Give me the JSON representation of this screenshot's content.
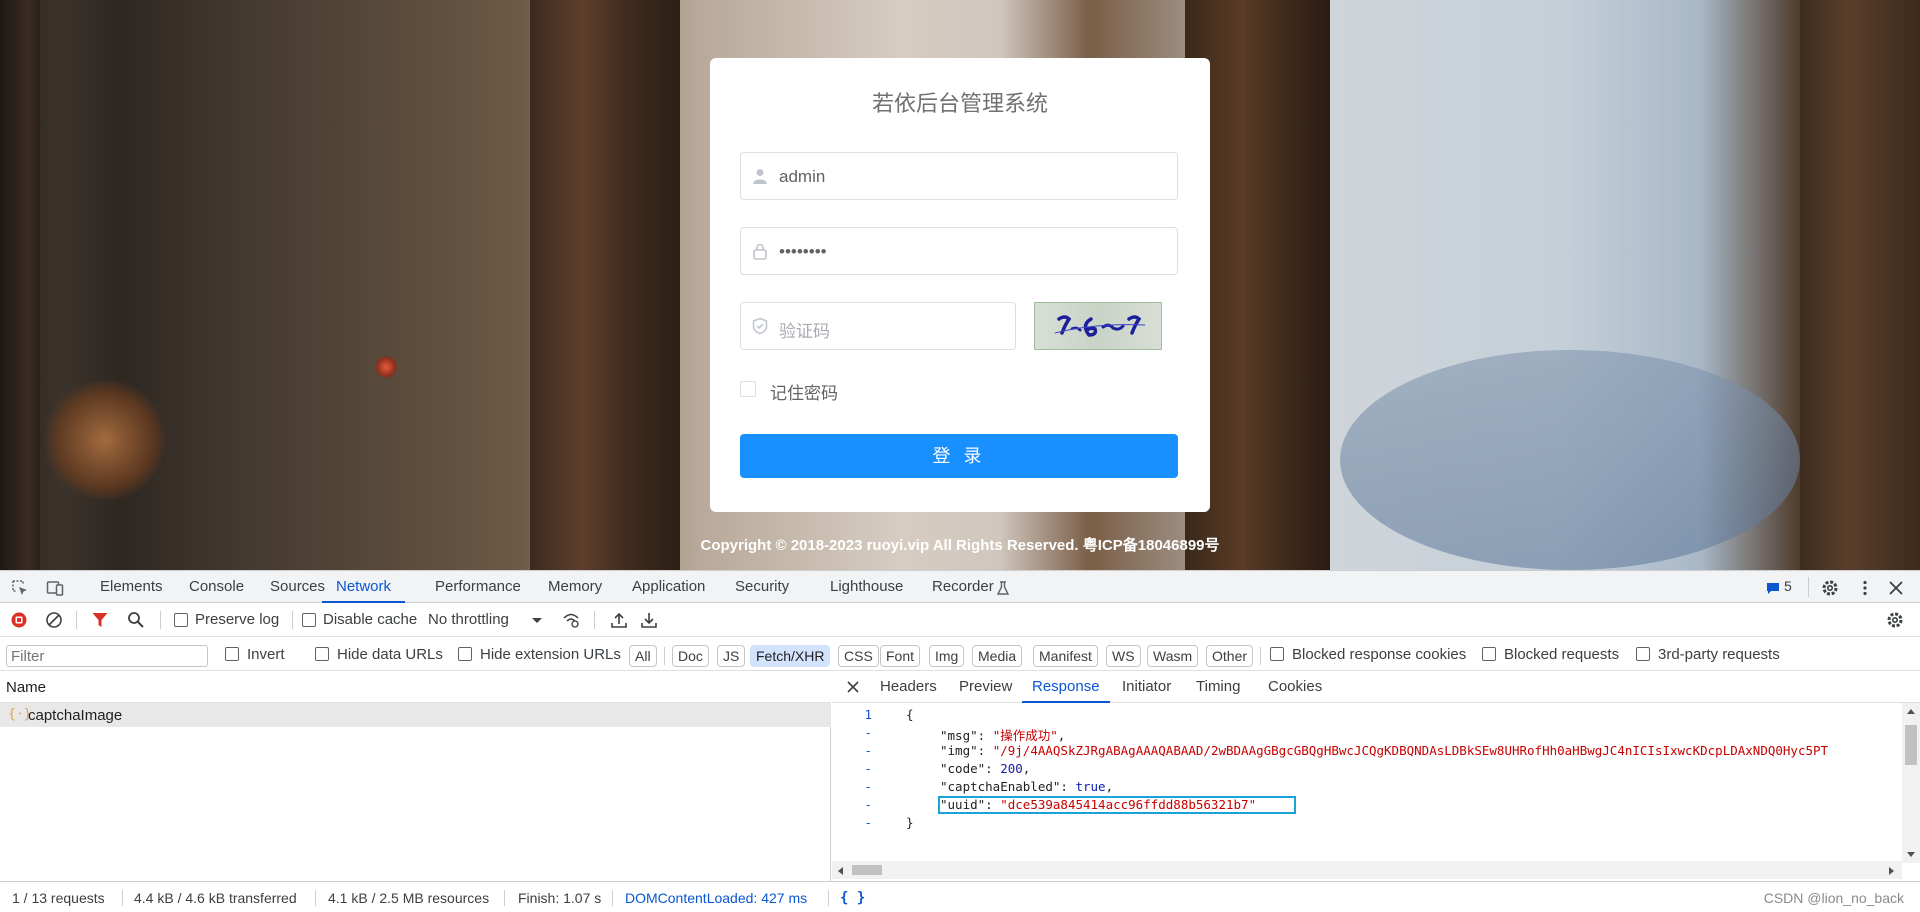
{
  "login": {
    "title": "若依后台管理系统",
    "username": "admin",
    "password_mask": "••••••••",
    "code_placeholder": "验证码",
    "remember_label": "记住密码",
    "login_button": "登 录",
    "copyright": "Copyright © 2018-2023 ruoyi.vip All Rights Reserved. 粤ICP备18046899号"
  },
  "devtools": {
    "tabs": [
      "Elements",
      "Console",
      "Sources",
      "Network",
      "Performance",
      "Memory",
      "Application",
      "Security",
      "Lighthouse",
      "Recorder"
    ],
    "active_tab": "Network",
    "issues_count": "5",
    "toolbar": {
      "preserve_log": "Preserve log",
      "disable_cache": "Disable cache",
      "throttling": "No throttling"
    },
    "filter": {
      "placeholder": "Filter",
      "invert": "Invert",
      "hide_data_urls": "Hide data URLs",
      "hide_extension_urls": "Hide extension URLs",
      "types": [
        "All",
        "Doc",
        "JS",
        "Fetch/XHR",
        "CSS",
        "Font",
        "Img",
        "Media",
        "Manifest",
        "WS",
        "Wasm",
        "Other"
      ],
      "active_type": "Fetch/XHR",
      "blocked_response_cookies": "Blocked response cookies",
      "blocked_requests": "Blocked requests",
      "third_party": "3rd-party requests"
    },
    "name_header": "Name",
    "requests": [
      {
        "name": "captchaImage"
      }
    ],
    "detail_tabs": [
      "Headers",
      "Preview",
      "Response",
      "Initiator",
      "Timing",
      "Cookies"
    ],
    "active_detail_tab": "Response",
    "response": {
      "line_numbers": [
        "1",
        "-",
        "-",
        "-",
        "-",
        "-",
        "-"
      ],
      "open_brace": "{",
      "close_brace": "}",
      "msg_key": "\"msg\"",
      "msg_val": "\"操作成功\"",
      "img_key": "\"img\"",
      "img_val": "\"/9j/4AAQSkZJRgABAgAAAQABAAD/2wBDAAgGBgcGBQgHBwcJCQgKDBQNDAsLDBkSEw8UHRofHh0aHBwgJC4nICIsIxwcKDcpLDAxNDQ0Hyc5PT",
      "code_key": "\"code\"",
      "code_val": "200",
      "captcha_key": "\"captchaEnabled\"",
      "captcha_val": "true",
      "uuid_key": "\"uuid\"",
      "uuid_val": "\"dce539a845414acc96ffdd88b56321b7\""
    },
    "status": {
      "requests": "1 / 13 requests",
      "transferred": "4.4 kB / 4.6 kB transferred",
      "resources": "4.1 kB / 2.5 MB resources",
      "finish": "Finish: 1.07 s",
      "dcl": "DOMContentLoaded: 427 ms",
      "format": "{ }"
    },
    "watermark": "CSDN @lion_no_back",
    "accent_color": "#0b57d0",
    "button_color": "#1890ff"
  }
}
